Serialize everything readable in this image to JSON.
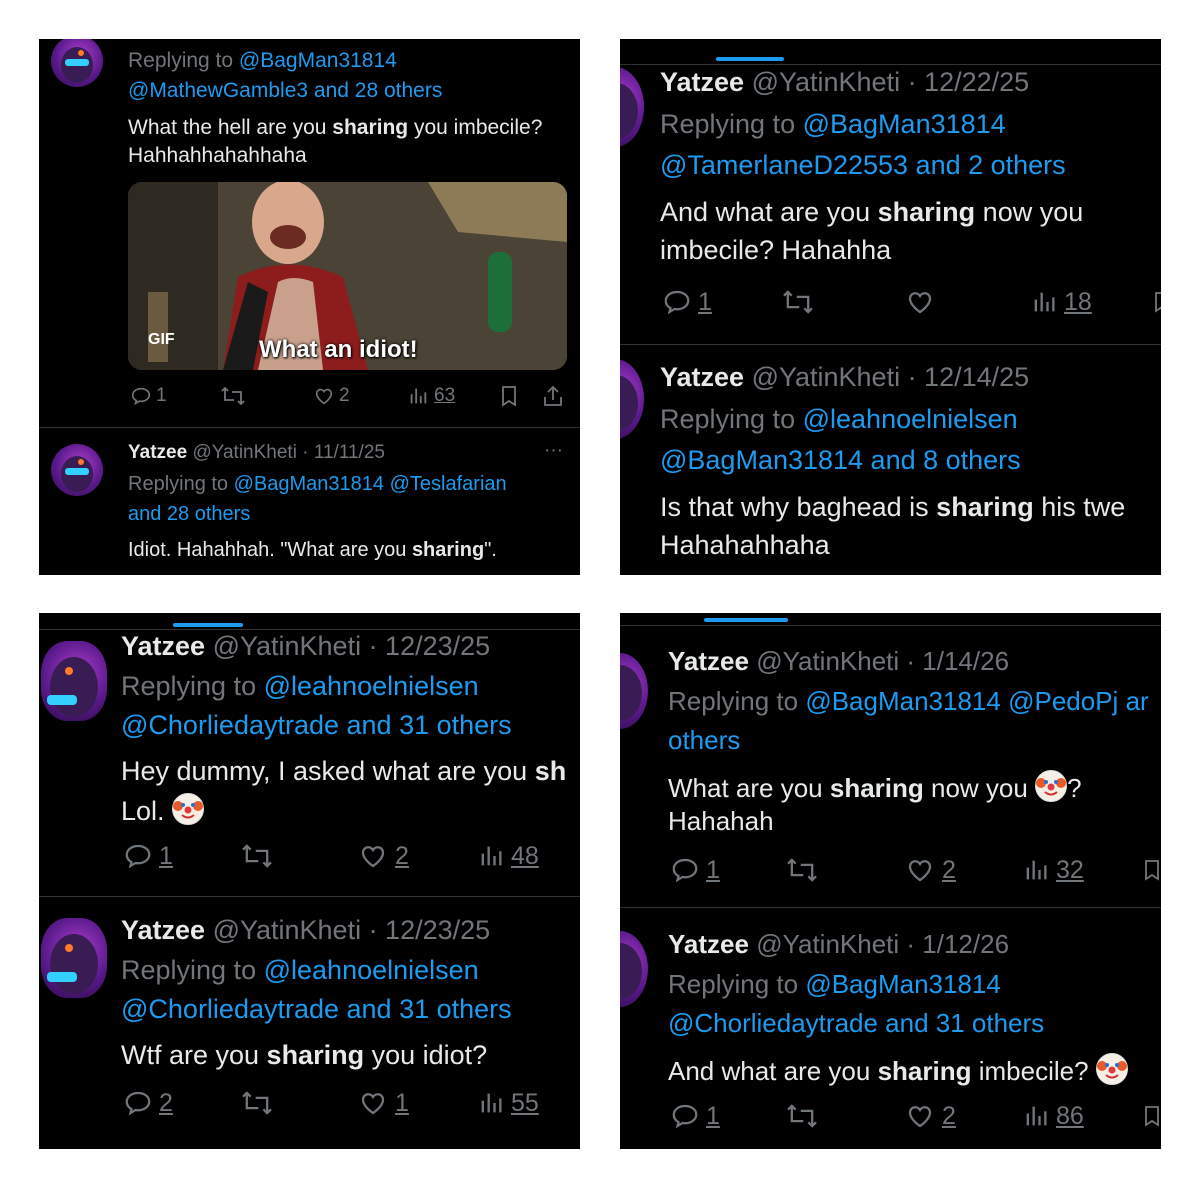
{
  "panel1": {
    "reply1": {
      "replying_prefix": "Replying to",
      "replying_handle1": "@BagMan31814",
      "replying_rest": "@MathewGamble3 and 28 others",
      "text_a": "What the hell are you ",
      "text_bold": "sharing",
      "text_b": " you imbecile?",
      "text_line2": "Hahhahhahahhaha",
      "gif_badge": "GIF",
      "gif_caption": "What an idiot!",
      "replies": "1",
      "likes": "2",
      "views": "63"
    },
    "reply2": {
      "name": "Yatzee",
      "handle_date": "@YatinKheti · 11/11/25",
      "more": "···",
      "replying_prefix": "Replying to",
      "replying_handle1": "@BagMan31814",
      "replying_handle2": "@Teslafarian",
      "replying_rest": "and 28 others",
      "text_a": "Idiot. Hahahhah. \"What are you ",
      "text_bold": "sharing",
      "text_b": "\"."
    }
  },
  "panel2": {
    "reply1": {
      "name": "Yatzee",
      "handle_date": "@YatinKheti · 12/22/25",
      "replying_prefix": "Replying to",
      "replying_handle1": "@BagMan31814",
      "replying_rest": "@TamerlaneD22553 and 2 others",
      "text_a": "And what are you ",
      "text_bold": "sharing",
      "text_b": " now you",
      "text_line2": "imbecile? Hahahha",
      "replies": "1",
      "views": "18"
    },
    "reply2": {
      "name": "Yatzee",
      "handle_date": "@YatinKheti · 12/14/25",
      "replying_prefix": "Replying to",
      "replying_handle1": "@leahnoelnielsen",
      "replying_rest": "@BagMan31814 and 8 others",
      "text_a": "Is that why baghead is ",
      "text_bold": "sharing",
      "text_b": " his twe",
      "text_line2": "Hahahahhaha"
    }
  },
  "panel3": {
    "reply1": {
      "name": "Yatzee",
      "handle_date": "@YatinKheti · 12/23/25",
      "replying_prefix": "Replying to",
      "replying_handle1": "@leahnoelnielsen",
      "replying_rest": "@Chorliedaytrade and 31 others",
      "text_a": "Hey dummy, I asked what are you ",
      "text_bold": "sh",
      "text_line2": "Lol.",
      "replies": "1",
      "likes": "2",
      "views": "48"
    },
    "reply2": {
      "name": "Yatzee",
      "handle_date": "@YatinKheti · 12/23/25",
      "replying_prefix": "Replying to",
      "replying_handle1": "@leahnoelnielsen",
      "replying_rest": "@Chorliedaytrade and 31 others",
      "text_a": "Wtf are you ",
      "text_bold": "sharing",
      "text_b": " you idiot?",
      "replies": "2",
      "likes": "1",
      "views": "55"
    }
  },
  "panel4": {
    "reply1": {
      "name": "Yatzee",
      "handle_date": "@YatinKheti · 1/14/26",
      "replying_prefix": "Replying to",
      "replying_handle1": "@BagMan31814",
      "replying_handle2": "@PedoPj",
      "replying_cut": "ar",
      "replying_line2": "others",
      "text_a": "What are you ",
      "text_bold": "sharing",
      "text_b": " now you ",
      "text_c": "?",
      "text_line2": "Hahahah",
      "replies": "1",
      "likes": "2",
      "views": "32"
    },
    "reply2": {
      "name": "Yatzee",
      "handle_date": "@YatinKheti · 1/12/26",
      "replying_prefix": "Replying to",
      "replying_handle1": "@BagMan31814",
      "replying_rest": "@Chorliedaytrade and 31 others",
      "text_a": "And what are you ",
      "text_bold": "sharing",
      "text_b": " imbecile? ",
      "replies": "1",
      "likes": "2",
      "views": "86"
    }
  },
  "icons": [
    "reply-icon",
    "retweet-icon",
    "like-icon",
    "views-icon",
    "bookmark-icon",
    "share-icon",
    "avatar",
    "clown-emoji"
  ],
  "colors": {
    "background": "#000000",
    "text": "#e7e9ea",
    "muted": "#71767b",
    "link": "#1d9bf0",
    "divider": "#2f3336"
  }
}
